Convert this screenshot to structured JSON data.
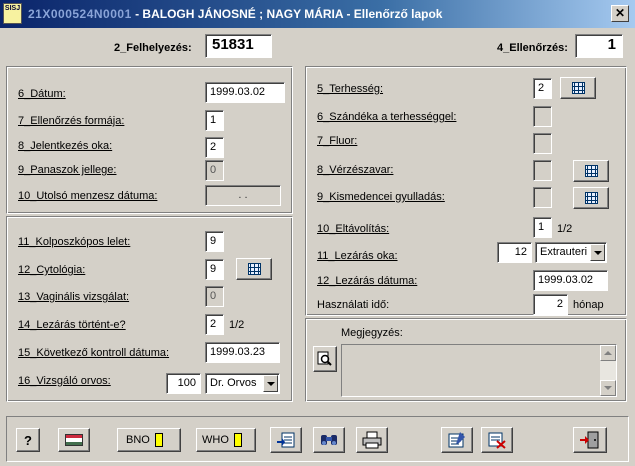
{
  "window": {
    "app_icon_text": "SISJ",
    "title_id": "21X000524N0001",
    "title_rest": " - BALOGH JÁNOSNÉ ; NAGY MÁRIA  - Ellenőrző lapok",
    "close_glyph": "✕"
  },
  "header": {
    "felhelyezes_label": "2_Felhelyezés:",
    "felhelyezes_value": "51831",
    "ellenorzes_label": "4_Ellenőrzés:",
    "ellenorzes_value": "1"
  },
  "left_top": {
    "datum_label": "6_Dátum:",
    "datum_value": "1999.03.02",
    "forma_label": "7_Ellenőrzés formája:",
    "forma_value": "1",
    "jelentkezes_label": "8_Jelentkezés oka:",
    "jelentkezes_value": "2",
    "panaszok_label": "9_Panaszok jellege:",
    "panaszok_value": "0",
    "menzesz_label": "10_Utolsó menzesz dátuma:",
    "menzesz_value": ". ."
  },
  "left_bottom": {
    "kolposz_label": "11_Kolposzkópos lelet:",
    "kolposz_value": "9",
    "cyto_label": "12_Cytológia:",
    "cyto_value": "9",
    "vaginalis_label": "13_Vaginális vizsgálat:",
    "vaginalis_value": "0",
    "lezaras_label": "14_Lezárás történt-e?",
    "lezaras_value": "2",
    "lezaras_hint": "1/2",
    "kontroll_label": "15_Következő kontroll dátuma:",
    "kontroll_value": "1999.03.23",
    "orvos_label": "16_Vizsgáló orvos:",
    "orvos_code": "100",
    "orvos_name": "Dr. Orvos"
  },
  "right": {
    "terhesseg_label": "5_Terhesség:",
    "terhesseg_value": "2",
    "szandek_label": "6_Szándéka a terhességgel:",
    "fluor_label": "7_Fluor:",
    "verzes_label": "8_Vérzészavar:",
    "kismed_label": "9_Kismedencei gyulladás:",
    "eltavolitas_label": "10_Eltávolítás:",
    "eltavolitas_value": "1",
    "eltavolitas_hint": "1/2",
    "lezaras_oka_label": "11_Lezárás oka:",
    "lezaras_oka_code": "12",
    "lezaras_oka_text": "Extrauteri",
    "lezaras_datum_label": "12_Lezárás dátuma:",
    "lezaras_datum_value": "1999.03.02",
    "hasznalati_label": "Használati idő:",
    "hasznalati_value": "2",
    "hasznalati_unit": "hónap",
    "megjegyzes_label": "Megjegyzés:"
  },
  "toolbar": {
    "help": "?",
    "bno": "BNO",
    "who": "WHO"
  },
  "colors": {
    "title_start": "#0a246a",
    "title_end": "#a6caf0",
    "indicator": "#ffff00"
  }
}
